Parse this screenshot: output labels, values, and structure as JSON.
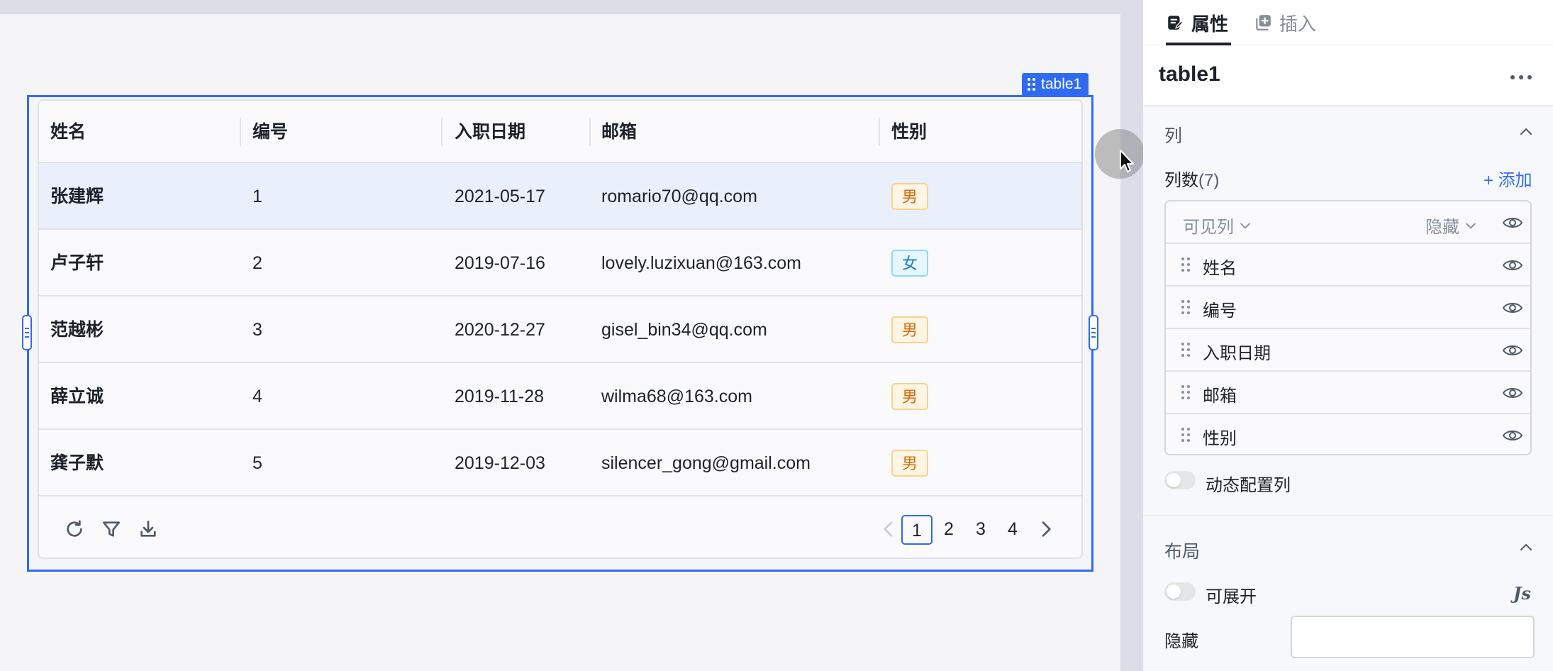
{
  "canvas": {
    "component_label": "table1",
    "table": {
      "columns": [
        "姓名",
        "编号",
        "入职日期",
        "邮箱",
        "性别"
      ],
      "rows": [
        {
          "name": "张建辉",
          "id": "1",
          "date": "2021-05-17",
          "email": "romario70@qq.com",
          "gender": "男",
          "gender_type": "m"
        },
        {
          "name": "卢子轩",
          "id": "2",
          "date": "2019-07-16",
          "email": "lovely.luzixuan@163.com",
          "gender": "女",
          "gender_type": "f"
        },
        {
          "name": "范越彬",
          "id": "3",
          "date": "2020-12-27",
          "email": "gisel_bin34@qq.com",
          "gender": "男",
          "gender_type": "m"
        },
        {
          "name": "薛立诚",
          "id": "4",
          "date": "2019-11-28",
          "email": "wilma68@163.com",
          "gender": "男",
          "gender_type": "m"
        },
        {
          "name": "龚子默",
          "id": "5",
          "date": "2019-12-03",
          "email": "silencer_gong@gmail.com",
          "gender": "男",
          "gender_type": "m"
        }
      ],
      "footer_icons": [
        "refresh-icon",
        "filter-icon",
        "download-icon"
      ],
      "pagination": {
        "pages": [
          "1",
          "2",
          "3",
          "4"
        ],
        "current": "1"
      }
    }
  },
  "panel": {
    "tabs": [
      {
        "label": "属性",
        "icon": "edit-document-icon",
        "active": true
      },
      {
        "label": "插入",
        "icon": "add-copy-icon",
        "active": false
      }
    ],
    "component_name": "table1",
    "columns_section": {
      "title": "列",
      "count_label": "列数",
      "count": "(7)",
      "add_label": "+ 添加",
      "visible_filter": "可见列",
      "hide_filter": "隐藏",
      "items": [
        "姓名",
        "编号",
        "入职日期",
        "邮箱",
        "性别"
      ],
      "dynamic_config_label": "动态配置列"
    },
    "layout_section": {
      "title": "布局",
      "expandable_label": "可展开",
      "hidden_label": "隐藏",
      "js_label": "Js"
    }
  },
  "colors": {
    "accent": "#2f6bf2",
    "tag_male_bg": "#fff5e5",
    "tag_female_bg": "#e6f7ff",
    "selected_row": "#e9effb"
  }
}
